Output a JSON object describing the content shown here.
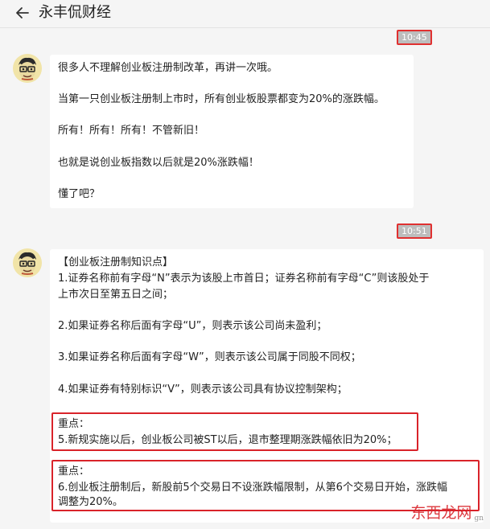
{
  "header": {
    "title": "永丰侃财经"
  },
  "messages": [
    {
      "time": "10:45",
      "lines": [
        "很多人不理解创业板注册制改革，再讲一次哦。",
        "当第一只创业板注册制上市时，所有创业板股票都变为20%的涨跌幅。",
        "所有！所有！所有！不管新旧！",
        "也就是说创业板指数以后就是20%涨跌幅！",
        "懂了吧？"
      ]
    },
    {
      "time": "10:51",
      "heading": "【创业板注册制知识点】",
      "lines": [
        "1.证券名称前有字母“N”表示为该股上市首日；证券名称前有字母“C”则该股处于",
        "上市次日至第五日之间；",
        "2.如果证券名称后面有字母“U”，则表示该公司尚未盈利；",
        "3.如果证券名称后面有字母“W”，则表示该公司属于同股不同权；",
        "4.如果证券有特别标识“V”，则表示该公司具有协议控制架构；"
      ],
      "key_points": [
        {
          "label": "重点：",
          "lines": [
            "5.新规实施以后，创业板公司被ST以后，退市整理期涨跌幅依旧为20%；"
          ]
        },
        {
          "label": "重点：",
          "lines": [
            "6.创业板注册制后，新股前5个交易日不设涨跌幅限制，从第6个交易日开始，涨跌幅",
            "调整为20%。"
          ]
        }
      ]
    }
  ],
  "watermark": {
    "text": "东西龙网",
    "sub": "gn"
  },
  "colors": {
    "highlight": "#d9232a",
    "timestamp_bg": "#bdbdbd"
  }
}
